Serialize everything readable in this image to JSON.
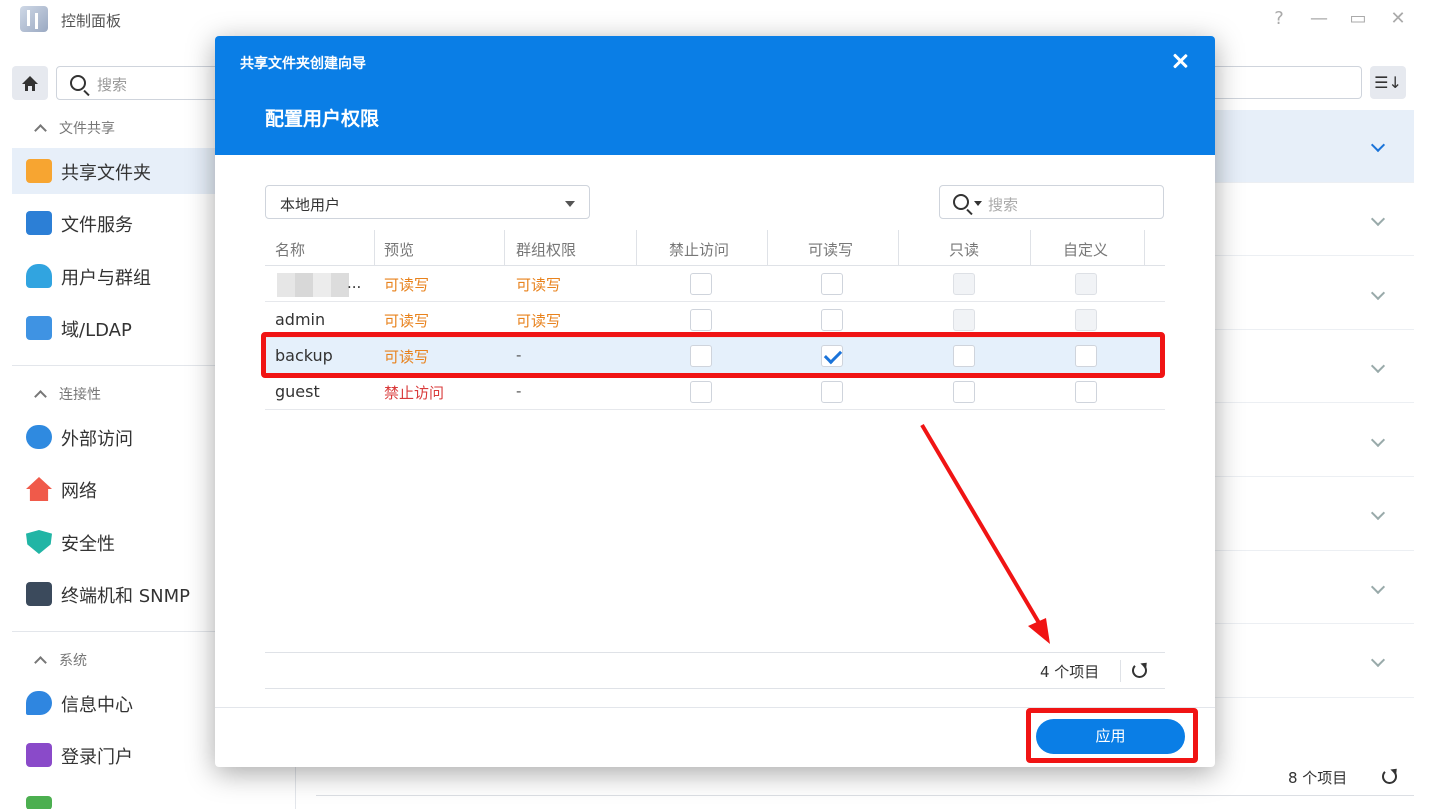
{
  "app": {
    "title": "控制面板",
    "window_controls": [
      "?",
      "—",
      "▭",
      "✕"
    ]
  },
  "sidebar": {
    "search_placeholder": "搜索",
    "sections": [
      {
        "title": "文件共享",
        "items": [
          "共享文件夹",
          "文件服务",
          "用户与群组",
          "域/LDAP"
        ]
      },
      {
        "title": "连接性",
        "items": [
          "外部访问",
          "网络",
          "安全性",
          "终端机和 SNMP"
        ]
      },
      {
        "title": "系统",
        "items": [
          "信息中心",
          "登录门户"
        ]
      }
    ],
    "active_item": "共享文件夹"
  },
  "right_pane": {
    "count": "8 个项目"
  },
  "dialog": {
    "wizard_title": "共享文件夹创建向导",
    "step_title": "配置用户权限",
    "user_type": "本地用户",
    "search_placeholder": "搜索",
    "columns": [
      "名称",
      "预览",
      "群组权限",
      "禁止访问",
      "可读写",
      "只读",
      "自定义"
    ],
    "rows": [
      {
        "name": "...",
        "preview": "可读写",
        "group": "可读写",
        "deny": false,
        "rw": false,
        "ro": false,
        "custom": false
      },
      {
        "name": "admin",
        "preview": "可读写",
        "group": "可读写",
        "deny": false,
        "rw": false,
        "ro": false,
        "custom": false
      },
      {
        "name": "backup",
        "preview": "可读写",
        "group": "-",
        "deny": false,
        "rw": true,
        "ro": false,
        "custom": false
      },
      {
        "name": "guest",
        "preview": "禁止访问",
        "group": "-",
        "deny": false,
        "rw": false,
        "ro": false,
        "custom": false
      }
    ],
    "item_count": "4 个项目",
    "apply_label": "应用"
  },
  "colors": {
    "accent": "#0a7ee6",
    "warning_text": "#e8821c",
    "deny_text": "#d93a3a",
    "annotation": "#f01414"
  }
}
